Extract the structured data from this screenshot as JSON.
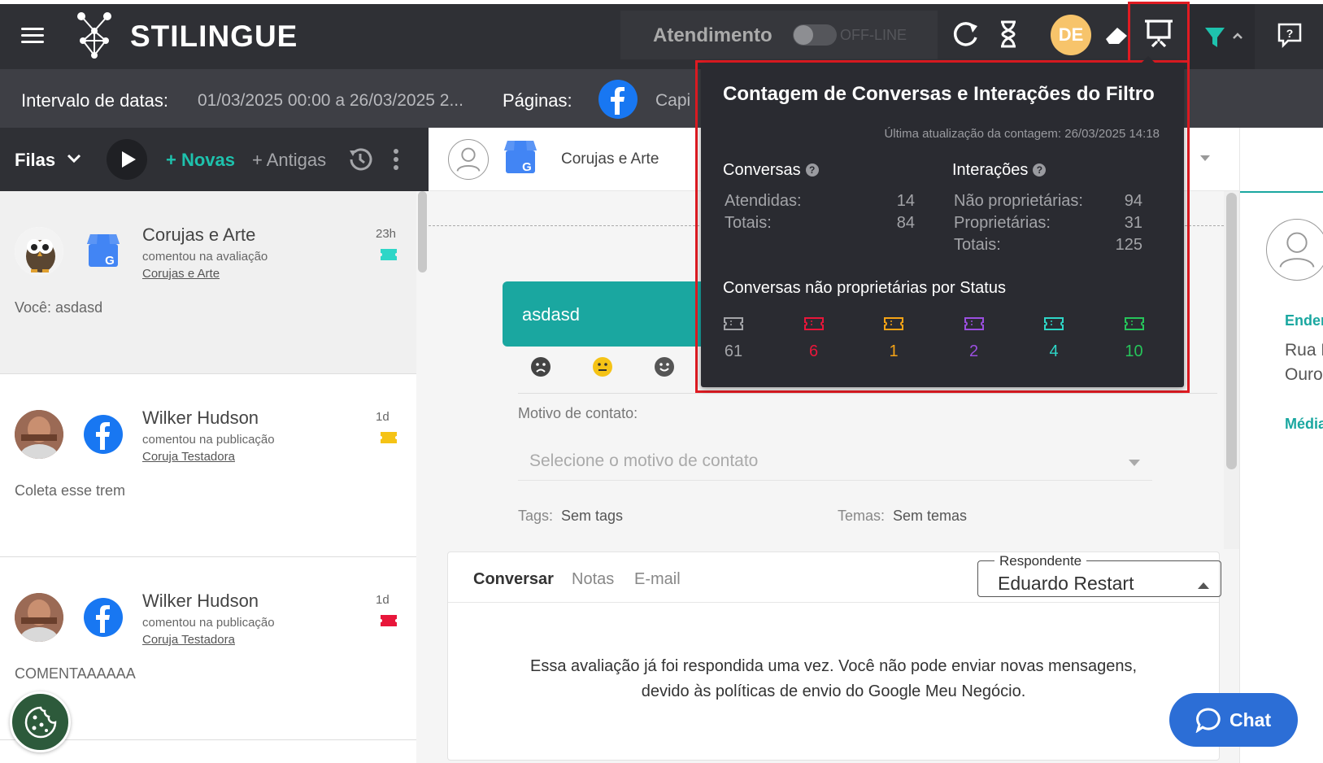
{
  "app": {
    "name": "STILINGUE"
  },
  "topbar": {
    "atendimento_label": "Atendimento",
    "status_label": "OFF-LINE",
    "user_initials": "DE"
  },
  "filterbar": {
    "interval_label": "Intervalo de datas:",
    "interval_value": "01/03/2025 00:00 a 26/03/2025 2...",
    "pages_label": "Páginas:",
    "pages_value": "Capi"
  },
  "queue": {
    "filas_label": "Filas",
    "novas_label": "+ Novas",
    "antigas_label": "+ Antigas"
  },
  "conversations": [
    {
      "name": "Corujas e Arte",
      "action": "comentou na avaliação",
      "link": "Corujas e Arte",
      "time": "23h",
      "message": "Você: asdasd",
      "source": "google-my-business",
      "ticket_color": "#2ed6c7"
    },
    {
      "name": "Wilker Hudson",
      "action": "comentou na publicação",
      "link": "Coruja Testadora",
      "time": "1d",
      "message": "Coleta esse trem",
      "source": "facebook",
      "ticket_color": "#f5c316"
    },
    {
      "name": "Wilker Hudson",
      "action": "comentou na publicação",
      "link": "Coruja Testadora",
      "time": "1d",
      "message": "COMENTAAAAAA",
      "source": "facebook",
      "ticket_color": "#e8163a"
    }
  ],
  "detail": {
    "page_name": "Corujas e Arte",
    "message": "asdasd",
    "motivo_label": "Motivo de contato:",
    "motivo_placeholder": "Selecione o motivo de contato",
    "tags_label": "Tags:",
    "tags_value": "Sem tags",
    "temas_label": "Temas:",
    "temas_value": "Sem temas",
    "tabs": [
      "Conversar",
      "Notas",
      "E-mail"
    ],
    "respondente_label": "Respondente",
    "respondente_value": "Eduardo Restart",
    "notice_line1": "Essa avaliação já foi respondida uma vez. Você não pode enviar novas mensagens,",
    "notice_line2": "devido às políticas de envio do Google Meu Negócio."
  },
  "right_panel": {
    "endereco_label": "Ender",
    "address_line1": "Rua F",
    "address_line2": "Ouro",
    "media_label": "Média"
  },
  "chat_button": {
    "label": "Chat"
  },
  "popover": {
    "title": "Contagem de Conversas e Interações do Filtro",
    "updated": "Última atualização da contagem: 26/03/2025 14:18",
    "conversas": {
      "title": "Conversas",
      "rows": [
        {
          "label": "Atendidas:",
          "value": "14"
        },
        {
          "label": "Totais:",
          "value": "84"
        }
      ]
    },
    "interacoes": {
      "title": "Interações",
      "rows": [
        {
          "label": "Não proprietárias:",
          "value": "94"
        },
        {
          "label": "Proprietárias:",
          "value": "31"
        },
        {
          "label": "Totais:",
          "value": "125"
        }
      ]
    },
    "status_title": "Conversas não proprietárias por Status",
    "statuses": [
      {
        "value": "61",
        "color": "#a3a4a8"
      },
      {
        "value": "6",
        "color": "#e8163a"
      },
      {
        "value": "1",
        "color": "#f5a316"
      },
      {
        "value": "2",
        "color": "#9b4fe0"
      },
      {
        "value": "4",
        "color": "#2ed6c7"
      },
      {
        "value": "10",
        "color": "#26c45a"
      }
    ]
  }
}
